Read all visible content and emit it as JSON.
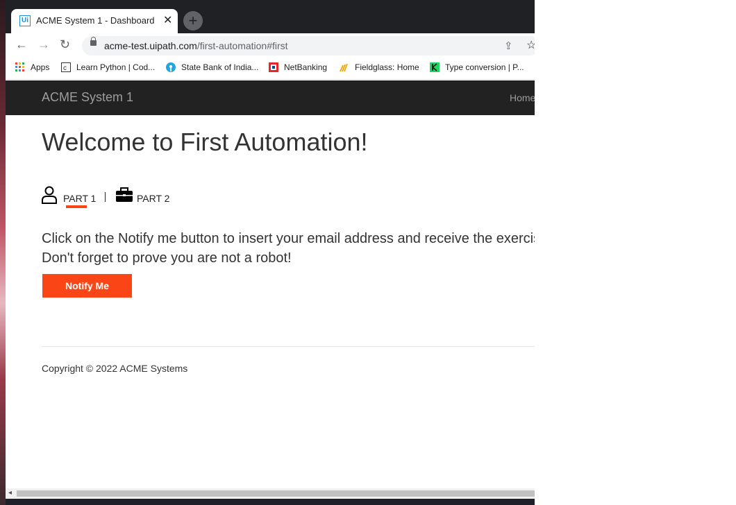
{
  "tab": {
    "favicon": "Ui",
    "title": "ACME System 1 - Dashboard",
    "close": "✕",
    "new_tab": "+"
  },
  "toolbar": {
    "back": "←",
    "forward": "→",
    "reload": "↻",
    "url_host": "acme-test.uipath.com",
    "url_path": "/first-automation#first",
    "share": "⇪",
    "star": "☆"
  },
  "bookmarks": [
    {
      "label": "Apps",
      "icon": "apps-grid-icon"
    },
    {
      "label": "Learn Python | Cod...",
      "icon": "codecademy-icon"
    },
    {
      "label": "State Bank of India...",
      "icon": "sbi-icon"
    },
    {
      "label": "NetBanking",
      "icon": "hdfc-icon"
    },
    {
      "label": "Fieldglass: Home",
      "icon": "fieldglass-icon"
    },
    {
      "label": "Type conversion | P...",
      "icon": "type-conversion-icon"
    }
  ],
  "navbar": {
    "brand": "ACME System 1",
    "home": "Home"
  },
  "main": {
    "heading": "Welcome to First Automation!",
    "tabs": [
      {
        "label": "PART 1",
        "icon": "user-icon"
      },
      {
        "label": "PART 2",
        "icon": "briefcase-icon"
      }
    ],
    "line1": "Click on the Notify me button to insert your email address and receive the exercis",
    "line2": "Don't forget to prove you are not a robot!",
    "notify_button": "Notify Me"
  },
  "footer": {
    "copyright": "Copyright © 2022 ACME Systems"
  },
  "colors": {
    "accent": "#fa4616",
    "navbar": "#222222",
    "tabstrip": "#202124"
  }
}
